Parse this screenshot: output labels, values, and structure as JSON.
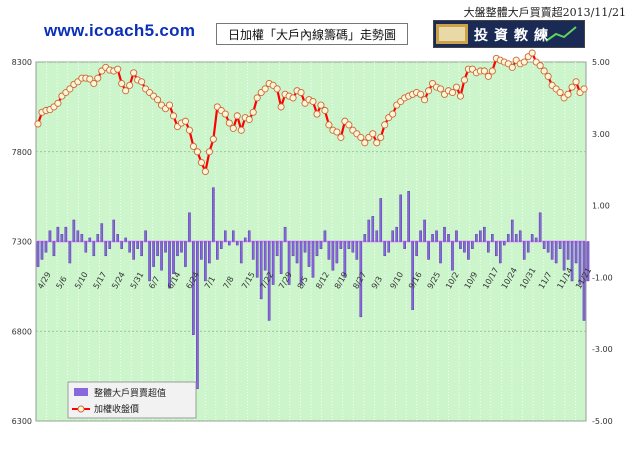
{
  "header": {
    "site_url": "www.icoach5.com",
    "chart_title": "日加權「大戶內線籌碼」走勢圖",
    "page_title": "大盤整體大戶買賣超2013/11/21",
    "logo_text": "投資教練"
  },
  "colors": {
    "plot_background": "#ccf5cc",
    "line": "#ff0000",
    "marker_fill": "#fff6d8",
    "bar": "#8866dd",
    "zero_line": "#e0a0ff"
  },
  "chart_data": {
    "type": "bar+line",
    "left_axis": {
      "ylim": [
        6300,
        8300
      ],
      "ticks": [
        "6300",
        "6800",
        "7300",
        "7800",
        "8300"
      ]
    },
    "right_axis": {
      "ylim": [
        -5.0,
        5.0
      ],
      "ticks": [
        "-5.00",
        "-3.00",
        "-1.00",
        "1.00",
        "3.00",
        "5.00"
      ]
    },
    "x_tick_labels": [
      "4/29",
      "5/6",
      "5/10",
      "5/17",
      "5/24",
      "5/31",
      "6/7",
      "6/14",
      "6/24",
      "7/1",
      "7/8",
      "7/15",
      "7/22",
      "7/29",
      "8/5",
      "8/12",
      "8/19",
      "8/27",
      "9/3",
      "9/10",
      "9/16",
      "9/25",
      "10/2",
      "10/9",
      "10/17",
      "10/24",
      "10/31",
      "11/7",
      "11/14",
      "11/21"
    ],
    "legend": {
      "position": "bottom-left",
      "bar_label": "整體大戶買賣超值",
      "line_label": "加權收盤價"
    },
    "series": [
      {
        "name": "加權收盤價",
        "type": "line",
        "axis": "left",
        "values": [
          7955,
          8020,
          8030,
          8035,
          8050,
          8070,
          8110,
          8130,
          8150,
          8175,
          8190,
          8210,
          8210,
          8205,
          8180,
          8210,
          8250,
          8270,
          8255,
          8250,
          8260,
          8180,
          8140,
          8170,
          8240,
          8200,
          8190,
          8150,
          8130,
          8110,
          8090,
          8060,
          8040,
          8060,
          8000,
          7940,
          7960,
          7970,
          7920,
          7830,
          7800,
          7740,
          7690,
          7800,
          7870,
          8050,
          8030,
          8010,
          7960,
          7930,
          8000,
          7920,
          7990,
          7980,
          8020,
          8100,
          8130,
          8150,
          8180,
          8170,
          8150,
          8050,
          8120,
          8110,
          8100,
          8140,
          8130,
          8070,
          8090,
          8080,
          8010,
          8060,
          8030,
          7950,
          7920,
          7910,
          7880,
          7970,
          7950,
          7920,
          7900,
          7880,
          7850,
          7880,
          7900,
          7850,
          7880,
          7950,
          7990,
          8010,
          8060,
          8080,
          8100,
          8110,
          8120,
          8130,
          8120,
          8090,
          8140,
          8180,
          8160,
          8150,
          8120,
          8140,
          8130,
          8160,
          8110,
          8200,
          8260,
          8260,
          8240,
          8250,
          8250,
          8220,
          8250,
          8320,
          8310,
          8300,
          8290,
          8270,
          8310,
          8290,
          8300,
          8330,
          8350,
          8300,
          8280,
          8250,
          8220,
          8170,
          8150,
          8130,
          8100,
          8120,
          8160,
          8190,
          8130,
          8150
        ]
      },
      {
        "name": "整體大戶買賣超值",
        "type": "bar",
        "axis": "right",
        "values": [
          -0.7,
          -0.5,
          -0.3,
          0.3,
          -0.4,
          0.4,
          0.2,
          0.4,
          -0.6,
          0.6,
          0.3,
          0.2,
          -0.3,
          0.1,
          -0.4,
          0.2,
          0.5,
          -0.4,
          -0.2,
          0.6,
          0.2,
          -0.2,
          0.1,
          -0.3,
          -0.5,
          -0.2,
          -0.4,
          0.3,
          -1.1,
          -0.7,
          -0.4,
          -0.8,
          -0.3,
          -1.3,
          -0.9,
          -0.4,
          -0.3,
          -0.7,
          0.8,
          -2.6,
          -4.1,
          -0.5,
          -1.1,
          -0.6,
          1.5,
          -0.5,
          -0.2,
          0.3,
          -0.1,
          0.3,
          -0.1,
          -0.6,
          0.1,
          0.3,
          -0.5,
          -1.0,
          -1.6,
          -0.8,
          -2.2,
          -1.2,
          -0.4,
          -0.9,
          0.4,
          -1.2,
          -0.4,
          -0.6,
          -1.2,
          -0.3,
          -0.7,
          -1.0,
          -0.4,
          -0.2,
          0.3,
          -0.5,
          -0.8,
          -0.6,
          -0.2,
          -1.0,
          -0.2,
          -0.3,
          -0.5,
          -2.1,
          0.2,
          0.6,
          0.7,
          0.3,
          1.2,
          -0.4,
          -0.3,
          0.3,
          0.4,
          1.3,
          -0.2,
          1.4,
          -1.9,
          -0.4,
          0.3,
          0.6,
          -0.5,
          0.2,
          0.3,
          -0.6,
          0.4,
          0.2,
          -0.8,
          0.3,
          -0.2,
          -0.3,
          -0.5,
          -0.2,
          0.2,
          0.3,
          0.4,
          -0.3,
          0.2,
          -0.4,
          -0.6,
          -0.1,
          0.2,
          0.6,
          0.2,
          0.3,
          -0.5,
          -0.3,
          0.2,
          0.1,
          0.8,
          -0.2,
          -0.3,
          -0.5,
          -0.6,
          -0.2,
          -0.8,
          -0.5,
          -1.1,
          -0.6,
          -1.2,
          -2.2,
          -1.1
        ]
      }
    ]
  }
}
